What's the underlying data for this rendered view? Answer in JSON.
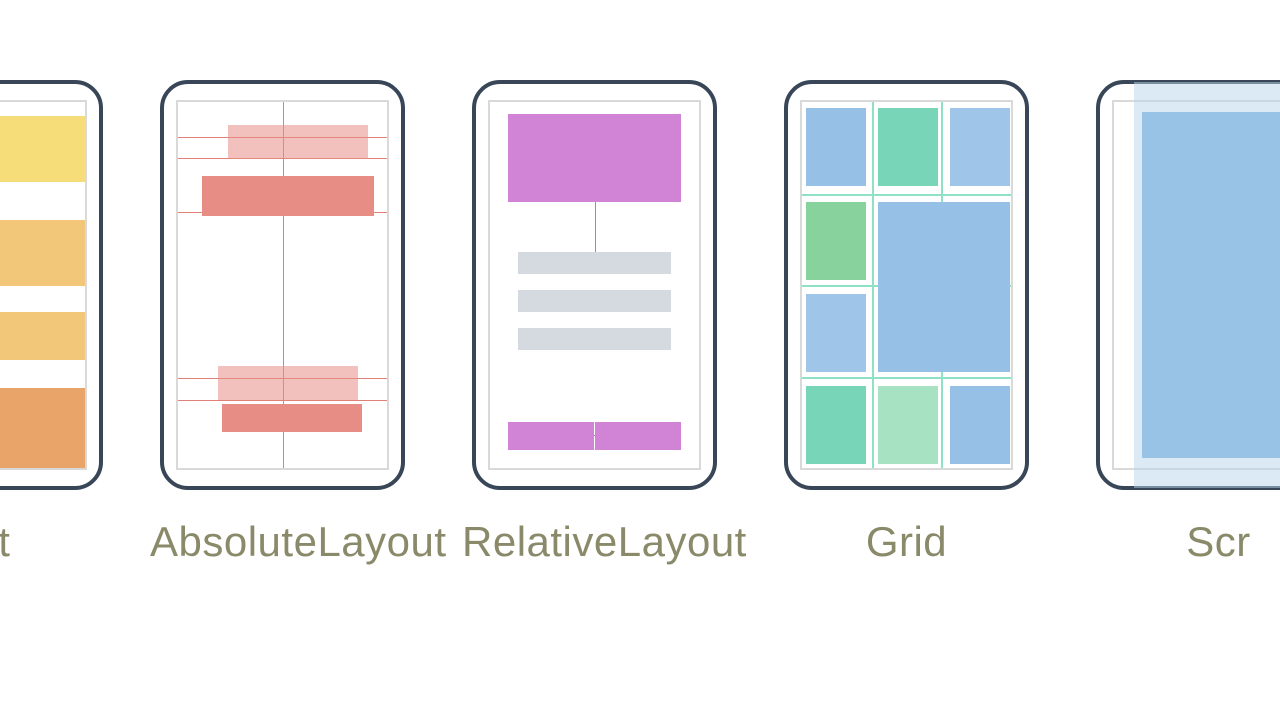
{
  "layouts": {
    "stack": {
      "label": "out",
      "full_label": "StackLayout"
    },
    "absolute": {
      "label": "AbsoluteLayout",
      "full_label": "AbsoluteLayout"
    },
    "relative": {
      "label": "RelativeLayout",
      "full_label": "RelativeLayout"
    },
    "grid": {
      "label": "Grid",
      "full_label": "Grid"
    },
    "scroll": {
      "label": "Scr",
      "full_label": "ScrollView"
    }
  },
  "colors": {
    "phone_border": "#384657",
    "screen_border": "#d9d9d9",
    "caption": "#8a8a6a",
    "stack_yellow": "#f6dd79",
    "stack_amber": "#f2c77a",
    "stack_orange": "#e8a469",
    "abs_red_solid": "#e88c86",
    "abs_red_soft": "rgba(232,140,134,0.55)",
    "abs_red_line": "#df8079",
    "rel_purple": "#d184d6",
    "rel_gray": "#d5dae0",
    "rel_line": "#c86ccf",
    "grid_line": "#8ee1c3",
    "grid_blue": "#97c0e6",
    "grid_teal": "#79d5b8",
    "grid_green": "#88d39d",
    "grid_mint": "#a7e3c3",
    "grid_sky": "#9fc5e8",
    "scroll_blue": "#99c3e6",
    "scroll_work": "#b8d5ec"
  }
}
